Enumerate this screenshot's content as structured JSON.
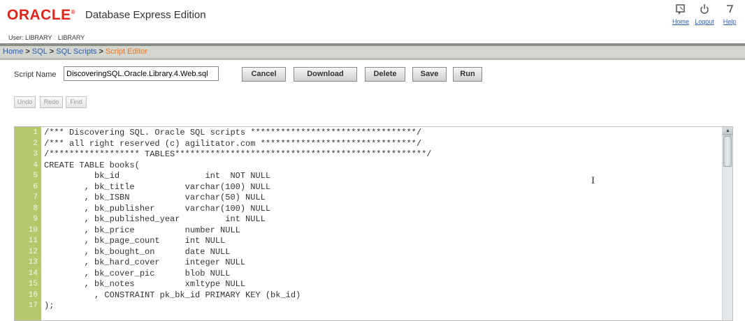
{
  "header": {
    "logo": "ORACLE",
    "logo_mark": "®",
    "product": "Database Express Edition",
    "user_label": "User: LIBRARY",
    "user_separator": ":",
    "user_schema": "LIBRARY",
    "icons": {
      "home": {
        "label": "Home",
        "icon": "home-icon"
      },
      "logout": {
        "label": "Logout",
        "icon": "power-icon"
      },
      "help": {
        "label": "Help",
        "icon": "help-icon"
      }
    }
  },
  "breadcrumb": {
    "items": [
      "Home",
      "SQL",
      "SQL Scripts"
    ],
    "separator": ">",
    "current": "Script Editor"
  },
  "script": {
    "name_label": "Script Name",
    "name_value": "DiscoveringSQL.Oracle.Library.4.Web.sql"
  },
  "toolbar": {
    "cancel": "Cancel",
    "download": "Download",
    "delete": "Delete",
    "save": "Save",
    "run": "Run"
  },
  "edit_toolbar": {
    "undo": "Undo",
    "redo": "Redo",
    "find": "Find"
  },
  "editor": {
    "lines": [
      {
        "n": "1",
        "text": "/*** Discovering SQL. Oracle SQL scripts *********************************/"
      },
      {
        "n": "2",
        "text": "/*** all right reserved (c) agilitator.com *******************************/"
      },
      {
        "n": "3",
        "text": "/****************** TABLES**************************************************/"
      },
      {
        "n": "4",
        "text": "CREATE TABLE books("
      },
      {
        "n": "5",
        "text": "          bk_id                 int  NOT NULL"
      },
      {
        "n": "6",
        "text": "        , bk_title          varchar(100) NULL"
      },
      {
        "n": "7",
        "text": "        , bk_ISBN           varchar(50) NULL"
      },
      {
        "n": "8",
        "text": "        , bk_publisher      varchar(100) NULL"
      },
      {
        "n": "9",
        "text": "        , bk_published_year         int NULL"
      },
      {
        "n": "10",
        "text": "        , bk_price          number NULL"
      },
      {
        "n": "11",
        "text": "        , bk_page_count     int NULL"
      },
      {
        "n": "12",
        "text": "        , bk_bought_on      date NULL"
      },
      {
        "n": "13",
        "text": "        , bk_hard_cover     integer NULL"
      },
      {
        "n": "14",
        "text": "        , bk_cover_pic      blob NULL"
      },
      {
        "n": "15",
        "text": "        , bk_notes          xmltype NULL"
      },
      {
        "n": "16",
        "text": "          , CONSTRAINT pk_bk_id PRIMARY KEY (bk_id)"
      },
      {
        "n": "17",
        "text": ");"
      }
    ],
    "gutter_color": "#b4c86c"
  },
  "colors": {
    "oracle_red": "#e2231a",
    "link_blue": "#2a5db0",
    "current_crumb": "#f0781e",
    "band": "#d3d6cf"
  }
}
